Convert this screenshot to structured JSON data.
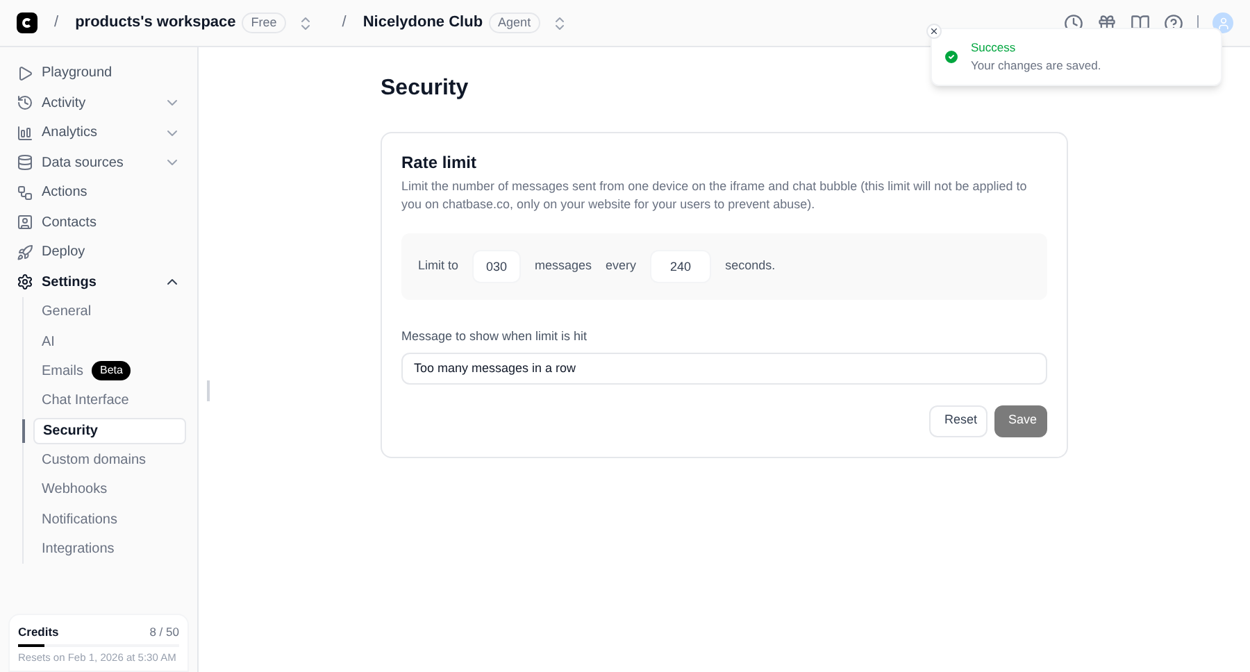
{
  "topbar": {
    "separators": [
      "/",
      "/"
    ],
    "workspace": "products's workspace",
    "workspace_badge": "Free",
    "agent": "Nicelydone Club",
    "agent_badge": "Agent"
  },
  "sidebar": {
    "items": [
      {
        "label": "Playground"
      },
      {
        "label": "Activity",
        "expanded": false
      },
      {
        "label": "Analytics",
        "expanded": false
      },
      {
        "label": "Data sources",
        "expanded": false
      },
      {
        "label": "Actions"
      },
      {
        "label": "Contacts"
      },
      {
        "label": "Deploy"
      },
      {
        "label": "Settings",
        "expanded": true,
        "children": [
          {
            "label": "General",
            "selected": false
          },
          {
            "label": "AI",
            "selected": false
          },
          {
            "label": "Emails",
            "badge": "Beta",
            "selected": false
          },
          {
            "label": "Chat Interface",
            "selected": false
          },
          {
            "label": "Security",
            "selected": true
          },
          {
            "label": "Custom domains",
            "selected": false
          },
          {
            "label": "Webhooks",
            "selected": false
          },
          {
            "label": "Notifications",
            "selected": false
          },
          {
            "label": "Integrations",
            "selected": false
          }
        ]
      }
    ],
    "credits": {
      "label": "Credits",
      "value": "8 / 50",
      "level": 0.16,
      "note": "Resets on Feb 1, 2026 at 5:30 AM"
    }
  },
  "page": {
    "title": "Security",
    "card": {
      "title": "Rate limit",
      "description": "Limit the number of messages sent from one device on the iframe and chat bubble (this limit will not be applied to you on chatbase.co, only on your website for your users to prevent abuse).",
      "limit_prefix": "Limit to",
      "messages_value": "030",
      "messages_label": "messages",
      "every_label": "every",
      "seconds_value": "240",
      "seconds_label": "seconds.",
      "message_label": "Message to show when limit is hit",
      "message_value": "Too many messages in a row",
      "buttons": [
        {
          "label": "Reset",
          "kind": "secondary"
        },
        {
          "label": "Save",
          "kind": "primary"
        }
      ]
    }
  },
  "toast": {
    "title": "Success",
    "message": "Your changes are saved."
  }
}
